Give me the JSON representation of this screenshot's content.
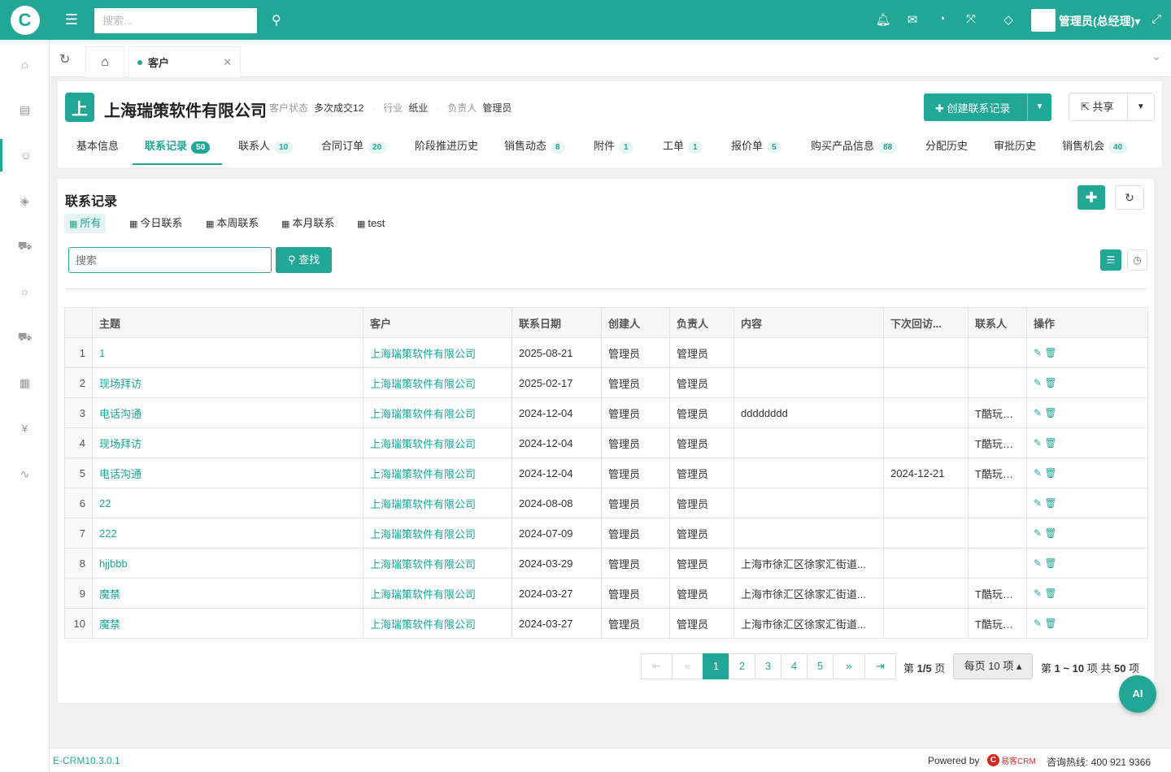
{
  "topbar": {
    "search_placeholder": "搜索...",
    "user_name": "管理员(总经理)▾"
  },
  "tabbar": {
    "current_tab": "客户"
  },
  "customer": {
    "avatar_letter": "上",
    "name": "上海瑞策软件有限公司",
    "status_label": "客户状态",
    "status_value": "多次成交12",
    "industry_label": "行业",
    "industry_value": "纸业",
    "owner_label": "负责人",
    "owner_value": "管理员",
    "create_label": "创建联系记录",
    "share_label": "共享"
  },
  "subtabs": [
    {
      "label": "基本信息",
      "badge": ""
    },
    {
      "label": "联系记录",
      "badge": "50"
    },
    {
      "label": "联系人",
      "badge": "10"
    },
    {
      "label": "合同订单",
      "badge": "20"
    },
    {
      "label": "阶段推进历史",
      "badge": ""
    },
    {
      "label": "销售动态",
      "badge": "8"
    },
    {
      "label": "附件",
      "badge": "1"
    },
    {
      "label": "工单",
      "badge": "1"
    },
    {
      "label": "报价单",
      "badge": "5"
    },
    {
      "label": "购买产品信息",
      "badge": "88"
    },
    {
      "label": "分配历史",
      "badge": ""
    },
    {
      "label": "审批历史",
      "badge": ""
    },
    {
      "label": "销售机会",
      "badge": "40"
    }
  ],
  "section": {
    "title": "联系记录",
    "filters": [
      "所有",
      "今日联系",
      "本周联系",
      "本月联系",
      "test"
    ],
    "search_placeholder": "搜索",
    "find_label": "查找"
  },
  "table": {
    "headers": [
      "主题",
      "客户",
      "联系日期",
      "创建人",
      "负责人",
      "内容",
      "下次回访...",
      "联系人",
      "操作"
    ],
    "rows": [
      {
        "no": "1",
        "subject": "1",
        "customer": "上海瑞策软件有限公司",
        "date": "2025-08-21",
        "creator": "管理员",
        "owner": "管理员",
        "content": "",
        "next": "",
        "contact": ""
      },
      {
        "no": "2",
        "subject": "现场拜访",
        "customer": "上海瑞策软件有限公司",
        "date": "2025-02-17",
        "creator": "管理员",
        "owner": "管理员",
        "content": "",
        "next": "",
        "contact": ""
      },
      {
        "no": "3",
        "subject": "电话沟通",
        "customer": "上海瑞策软件有限公司",
        "date": "2024-12-04",
        "creator": "管理员",
        "owner": "管理员",
        "content": "dddddddd",
        "next": "",
        "contact": "T酷玩贸..."
      },
      {
        "no": "4",
        "subject": "现场拜访",
        "customer": "上海瑞策软件有限公司",
        "date": "2024-12-04",
        "creator": "管理员",
        "owner": "管理员",
        "content": "",
        "next": "",
        "contact": "T酷玩贸..."
      },
      {
        "no": "5",
        "subject": "电话沟通",
        "customer": "上海瑞策软件有限公司",
        "date": "2024-12-04",
        "creator": "管理员",
        "owner": "管理员",
        "content": "",
        "next": "2024-12-21",
        "contact": "T酷玩贸..."
      },
      {
        "no": "6",
        "subject": "22",
        "customer": "上海瑞策软件有限公司",
        "date": "2024-08-08",
        "creator": "管理员",
        "owner": "管理员",
        "content": "",
        "next": "",
        "contact": ""
      },
      {
        "no": "7",
        "subject": "222",
        "customer": "上海瑞策软件有限公司",
        "date": "2024-07-09",
        "creator": "管理员",
        "owner": "管理员",
        "content": "",
        "next": "",
        "contact": ""
      },
      {
        "no": "8",
        "subject": "hjjbbb",
        "customer": "上海瑞策软件有限公司",
        "date": "2024-03-29",
        "creator": "管理员",
        "owner": "管理员",
        "content": "上海市徐汇区徐家汇街道...",
        "next": "",
        "contact": ""
      },
      {
        "no": "9",
        "subject": "魔禁",
        "customer": "上海瑞策软件有限公司",
        "date": "2024-03-27",
        "creator": "管理员",
        "owner": "管理员",
        "content": "上海市徐汇区徐家汇街道...",
        "next": "",
        "contact": "T酷玩贸..."
      },
      {
        "no": "10",
        "subject": "魔禁",
        "customer": "上海瑞策软件有限公司",
        "date": "2024-03-27",
        "creator": "管理员",
        "owner": "管理员",
        "content": "上海市徐汇区徐家汇街道...",
        "next": "",
        "contact": "T酷玩贸..."
      }
    ]
  },
  "pagination": {
    "pages": [
      "1",
      "2",
      "3",
      "4",
      "5"
    ],
    "current_page": "1",
    "page_info_prefix": "第",
    "page_info_value": "1/5",
    "page_info_suffix": "页",
    "page_size": "每页 10 项 ▴",
    "range_prefix": "第",
    "range_value": "1 ~ 10",
    "range_mid": "项 共",
    "range_total": "50",
    "range_suffix": "项"
  },
  "ai_label": "AI",
  "footer": {
    "version": "E-CRM10.3.0.1",
    "powered_by": "Powered by",
    "brand": "易客CRM",
    "hotline": "咨询热线: 400 921 9366"
  },
  "icons": {
    "menu": "menu-icon",
    "search": "search-icon",
    "bell": "bell-icon",
    "mail": "mail-icon",
    "dashboard": "dashboard-icon",
    "expand": "expand-icon",
    "tag": "tag-icon",
    "fullscreen": "fullscreen-icon"
  },
  "colors": {
    "accent": "#22a797"
  }
}
